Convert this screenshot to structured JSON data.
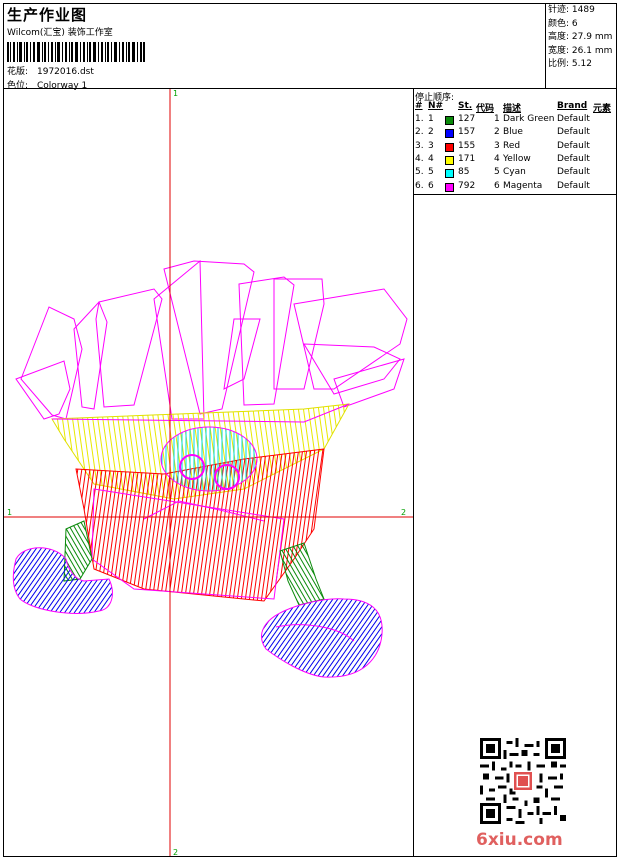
{
  "header": {
    "title": "生产作业图",
    "subtitle": "Wilcom(汇宝) 装饰工作室",
    "design_label": "花版:",
    "design_value": "1972016.dst",
    "colorway_label": "色位:",
    "colorway_value": "Colorway 1"
  },
  "stats": [
    {
      "label": "针迹:",
      "value": "1489"
    },
    {
      "label": "颜色:",
      "value": "6"
    },
    {
      "label": "高度:",
      "value": "27.9 mm"
    },
    {
      "label": "宽度:",
      "value": "26.1 mm"
    },
    {
      "label": "比例:",
      "value": "5.12"
    }
  ],
  "legend": {
    "title": "停止顺序:",
    "columns": [
      "#",
      "N#",
      "St.",
      "代码",
      "描述",
      "Brand",
      "元素"
    ],
    "rows": [
      {
        "num": "1.",
        "n": "1",
        "color": "#0a8a0a",
        "st": "127",
        "code": "1",
        "desc": "Dark Green",
        "brand": "Default"
      },
      {
        "num": "2.",
        "n": "2",
        "color": "#0000ff",
        "st": "157",
        "code": "2",
        "desc": "Blue",
        "brand": "Default"
      },
      {
        "num": "3.",
        "n": "3",
        "color": "#ff0000",
        "st": "155",
        "code": "3",
        "desc": "Red",
        "brand": "Default"
      },
      {
        "num": "4.",
        "n": "4",
        "color": "#ffff00",
        "st": "171",
        "code": "4",
        "desc": "Yellow",
        "brand": "Default"
      },
      {
        "num": "5.",
        "n": "5",
        "color": "#00ffff",
        "st": "85",
        "code": "5",
        "desc": "Cyan",
        "brand": "Default"
      },
      {
        "num": "6.",
        "n": "6",
        "color": "#ff00ff",
        "st": "792",
        "code": "6",
        "desc": "Magenta",
        "brand": "Default"
      }
    ]
  },
  "axis_labels": {
    "top": "1",
    "bottom": "2",
    "left": "1",
    "right": "2"
  },
  "watermark": "6xiu.com"
}
